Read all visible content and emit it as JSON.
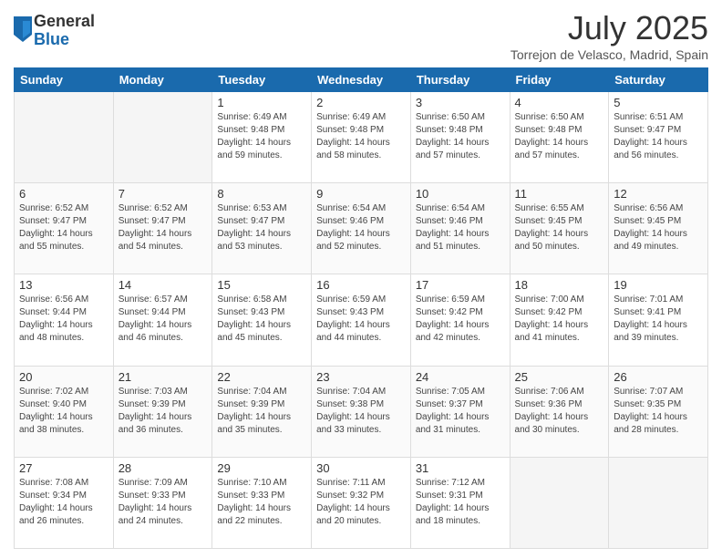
{
  "logo": {
    "general": "General",
    "blue": "Blue"
  },
  "title": {
    "month_year": "July 2025",
    "location": "Torrejon de Velasco, Madrid, Spain"
  },
  "headers": [
    "Sunday",
    "Monday",
    "Tuesday",
    "Wednesday",
    "Thursday",
    "Friday",
    "Saturday"
  ],
  "weeks": [
    [
      {
        "day": "",
        "detail": ""
      },
      {
        "day": "",
        "detail": ""
      },
      {
        "day": "1",
        "detail": "Sunrise: 6:49 AM\nSunset: 9:48 PM\nDaylight: 14 hours\nand 59 minutes."
      },
      {
        "day": "2",
        "detail": "Sunrise: 6:49 AM\nSunset: 9:48 PM\nDaylight: 14 hours\nand 58 minutes."
      },
      {
        "day": "3",
        "detail": "Sunrise: 6:50 AM\nSunset: 9:48 PM\nDaylight: 14 hours\nand 57 minutes."
      },
      {
        "day": "4",
        "detail": "Sunrise: 6:50 AM\nSunset: 9:48 PM\nDaylight: 14 hours\nand 57 minutes."
      },
      {
        "day": "5",
        "detail": "Sunrise: 6:51 AM\nSunset: 9:47 PM\nDaylight: 14 hours\nand 56 minutes."
      }
    ],
    [
      {
        "day": "6",
        "detail": "Sunrise: 6:52 AM\nSunset: 9:47 PM\nDaylight: 14 hours\nand 55 minutes."
      },
      {
        "day": "7",
        "detail": "Sunrise: 6:52 AM\nSunset: 9:47 PM\nDaylight: 14 hours\nand 54 minutes."
      },
      {
        "day": "8",
        "detail": "Sunrise: 6:53 AM\nSunset: 9:47 PM\nDaylight: 14 hours\nand 53 minutes."
      },
      {
        "day": "9",
        "detail": "Sunrise: 6:54 AM\nSunset: 9:46 PM\nDaylight: 14 hours\nand 52 minutes."
      },
      {
        "day": "10",
        "detail": "Sunrise: 6:54 AM\nSunset: 9:46 PM\nDaylight: 14 hours\nand 51 minutes."
      },
      {
        "day": "11",
        "detail": "Sunrise: 6:55 AM\nSunset: 9:45 PM\nDaylight: 14 hours\nand 50 minutes."
      },
      {
        "day": "12",
        "detail": "Sunrise: 6:56 AM\nSunset: 9:45 PM\nDaylight: 14 hours\nand 49 minutes."
      }
    ],
    [
      {
        "day": "13",
        "detail": "Sunrise: 6:56 AM\nSunset: 9:44 PM\nDaylight: 14 hours\nand 48 minutes."
      },
      {
        "day": "14",
        "detail": "Sunrise: 6:57 AM\nSunset: 9:44 PM\nDaylight: 14 hours\nand 46 minutes."
      },
      {
        "day": "15",
        "detail": "Sunrise: 6:58 AM\nSunset: 9:43 PM\nDaylight: 14 hours\nand 45 minutes."
      },
      {
        "day": "16",
        "detail": "Sunrise: 6:59 AM\nSunset: 9:43 PM\nDaylight: 14 hours\nand 44 minutes."
      },
      {
        "day": "17",
        "detail": "Sunrise: 6:59 AM\nSunset: 9:42 PM\nDaylight: 14 hours\nand 42 minutes."
      },
      {
        "day": "18",
        "detail": "Sunrise: 7:00 AM\nSunset: 9:42 PM\nDaylight: 14 hours\nand 41 minutes."
      },
      {
        "day": "19",
        "detail": "Sunrise: 7:01 AM\nSunset: 9:41 PM\nDaylight: 14 hours\nand 39 minutes."
      }
    ],
    [
      {
        "day": "20",
        "detail": "Sunrise: 7:02 AM\nSunset: 9:40 PM\nDaylight: 14 hours\nand 38 minutes."
      },
      {
        "day": "21",
        "detail": "Sunrise: 7:03 AM\nSunset: 9:39 PM\nDaylight: 14 hours\nand 36 minutes."
      },
      {
        "day": "22",
        "detail": "Sunrise: 7:04 AM\nSunset: 9:39 PM\nDaylight: 14 hours\nand 35 minutes."
      },
      {
        "day": "23",
        "detail": "Sunrise: 7:04 AM\nSunset: 9:38 PM\nDaylight: 14 hours\nand 33 minutes."
      },
      {
        "day": "24",
        "detail": "Sunrise: 7:05 AM\nSunset: 9:37 PM\nDaylight: 14 hours\nand 31 minutes."
      },
      {
        "day": "25",
        "detail": "Sunrise: 7:06 AM\nSunset: 9:36 PM\nDaylight: 14 hours\nand 30 minutes."
      },
      {
        "day": "26",
        "detail": "Sunrise: 7:07 AM\nSunset: 9:35 PM\nDaylight: 14 hours\nand 28 minutes."
      }
    ],
    [
      {
        "day": "27",
        "detail": "Sunrise: 7:08 AM\nSunset: 9:34 PM\nDaylight: 14 hours\nand 26 minutes."
      },
      {
        "day": "28",
        "detail": "Sunrise: 7:09 AM\nSunset: 9:33 PM\nDaylight: 14 hours\nand 24 minutes."
      },
      {
        "day": "29",
        "detail": "Sunrise: 7:10 AM\nSunset: 9:33 PM\nDaylight: 14 hours\nand 22 minutes."
      },
      {
        "day": "30",
        "detail": "Sunrise: 7:11 AM\nSunset: 9:32 PM\nDaylight: 14 hours\nand 20 minutes."
      },
      {
        "day": "31",
        "detail": "Sunrise: 7:12 AM\nSunset: 9:31 PM\nDaylight: 14 hours\nand 18 minutes."
      },
      {
        "day": "",
        "detail": ""
      },
      {
        "day": "",
        "detail": ""
      }
    ]
  ]
}
